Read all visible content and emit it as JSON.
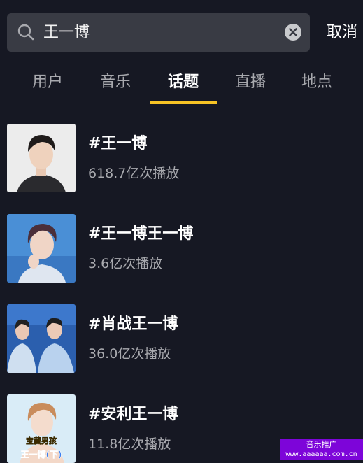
{
  "search": {
    "query": "王一博"
  },
  "header": {
    "cancel_label": "取消"
  },
  "tabs": [
    {
      "label": "用户"
    },
    {
      "label": "音乐"
    },
    {
      "label": "话题",
      "active": true
    },
    {
      "label": "直播"
    },
    {
      "label": "地点"
    }
  ],
  "topics": [
    {
      "title": "#王一博",
      "plays": "618.7亿次播放"
    },
    {
      "title": "#王一博王一博",
      "plays": "3.6亿次播放"
    },
    {
      "title": "#肖战王一博",
      "plays": "36.0亿次播放"
    },
    {
      "title": "#安利王一博",
      "plays": "11.8亿次播放"
    }
  ],
  "thumb_captions": {
    "t4_top": "宝藏男孩",
    "t4_bottom": "王一博(下)"
  },
  "promo": {
    "line1": "音乐推广",
    "line2": "www.aaaaaa.com.cn"
  },
  "colors": {
    "background": "#161823",
    "accent": "#f7c325",
    "promo": "#7d05d9"
  }
}
